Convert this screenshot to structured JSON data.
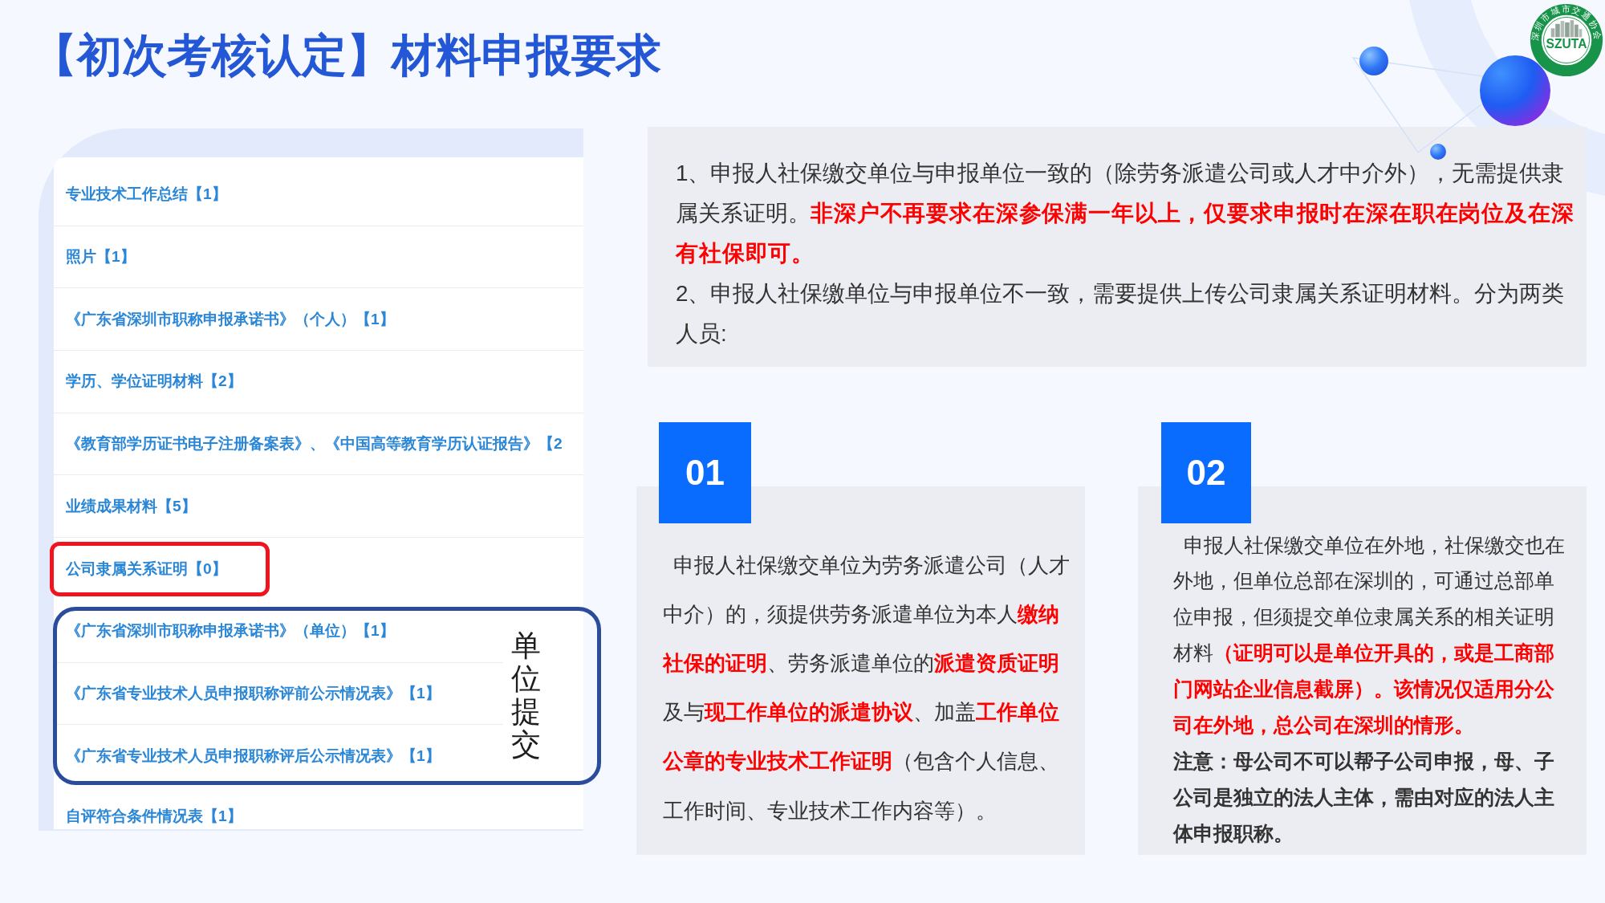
{
  "title": "【初次考核认定】材料申报要求",
  "logo": {
    "ring_text": "深圳市城市交通协会",
    "abbreviation": "SZUTA"
  },
  "materials_list": [
    {
      "kind": "item",
      "label": "专业技术工作总结【1】",
      "highlighted": false
    },
    {
      "kind": "item",
      "label": "照片【1】",
      "highlighted": false
    },
    {
      "kind": "item",
      "label": "《广东省深圳市职称申报承诺书》（个人）【1】",
      "highlighted": false
    },
    {
      "kind": "item",
      "label": "学历、学位证明材料【2】",
      "highlighted": false
    },
    {
      "kind": "item",
      "label": "《教育部学历证书电子注册备案表》、《中国高等教育学历认证报告》【2",
      "highlighted": false
    },
    {
      "kind": "item",
      "label": "业绩成果材料【5】",
      "highlighted": false
    },
    {
      "kind": "item",
      "label": "公司隶属关系证明【0】",
      "highlighted": true
    },
    {
      "kind": "group",
      "label": "单位提交",
      "items": [
        {
          "label": "《广东省深圳市职称申报承诺书》（单位）【1】",
          "highlighted": false
        },
        {
          "label": "《广东省专业技术人员申报职称评前公示情况表》【1】",
          "highlighted": false
        },
        {
          "label": "《广东省专业技术人员申报职称评后公示情况表》【1】",
          "highlighted": false
        }
      ]
    },
    {
      "kind": "item",
      "label": "自评符合条件情况表【1】",
      "highlighted": false
    }
  ],
  "requirements": [
    "1、申报人社保缴交单位与申报单位一致的（除劳务派遣公司或人才中介外），无需提供隶属关系证明。**非深户不再要求在深参保满一年以上，仅要求申报时在深在职在岗位及在深有社保即可。**",
    "2、申报人社保缴单位与申报单位不一致，需要提供上传公司隶属关系证明材料。分为两类人员:"
  ],
  "cases": [
    {
      "number": "01",
      "text": "申报人社保缴交单位为劳务派遣公司（人才中介）的，须提供劳务派遣单位为本人**缴纳社保的证明**、劳务派遣单位的**派遣资质证明**及与**现工作单位的派遣协议**、加盖**工作单位公章的专业技术工作证明**（包含个人信息、工作时间、专业技术工作内容等）。"
    },
    {
      "number": "02",
      "text": "申报人社保缴交单位在外地，社保缴交也在外地，但单位总部在深圳的，可通过总部单位申报，但须提交单位隶属关系的相关证明材料**（证明可以是单位开具的，或是工商部门网站企业信息截屏）。该情况仅适用分公司在外地，总公司在深圳的情形。**",
      "note": "注意：母公司不可以帮子公司申报，母、子公司是独立的法人主体，需由对应的法人主体申报职称。"
    }
  ]
}
